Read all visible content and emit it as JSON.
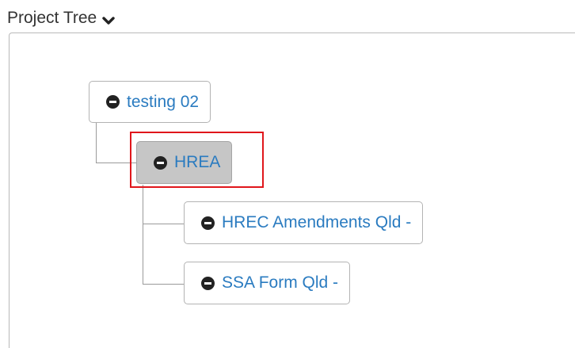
{
  "panel": {
    "title": "Project Tree",
    "toggle_icon": "chevron-down-icon"
  },
  "tree": {
    "collapse_icon": "minus-circle-icon",
    "root": {
      "label": "testing 02",
      "selected": false
    },
    "child": {
      "label": "HREA",
      "selected": true
    },
    "grandchildren": [
      {
        "label": "HREC Amendments Qld -",
        "selected": false
      },
      {
        "label": "SSA Form Qld -",
        "selected": false
      }
    ]
  },
  "colors": {
    "link": "#2a7bc0",
    "selected_bg": "#c6c6c6",
    "highlight": "#e0161b",
    "connector": "#9a9a9a"
  }
}
